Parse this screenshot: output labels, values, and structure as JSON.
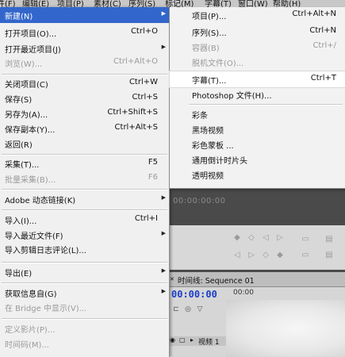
{
  "menubar": {
    "items": [
      "件(F)",
      "编辑(E)",
      "项目(P)",
      "素材(C)",
      "序列(S)",
      "标记(M)",
      "字幕(T)",
      "窗口(W)",
      "帮助(H)"
    ]
  },
  "file_menu": {
    "new": {
      "label": "新建(N)"
    },
    "open_project": {
      "label": "打开项目(O)...",
      "shortcut": "Ctrl+O"
    },
    "open_recent": {
      "label": "打开最近项目(J)"
    },
    "browse": {
      "label": "浏览(W)...",
      "shortcut": "Ctrl+Alt+O"
    },
    "close_project": {
      "label": "关闭项目(C)",
      "shortcut": "Ctrl+W"
    },
    "save": {
      "label": "保存(S)",
      "shortcut": "Ctrl+S"
    },
    "save_as": {
      "label": "另存为(A)...",
      "shortcut": "Ctrl+Shift+S"
    },
    "save_copy": {
      "label": "保存副本(Y)...",
      "shortcut": "Ctrl+Alt+S"
    },
    "revert": {
      "label": "返回(R)"
    },
    "capture": {
      "label": "采集(T)...",
      "shortcut": "F5"
    },
    "batch_capture": {
      "label": "批量采集(B)...",
      "shortcut": "F6"
    },
    "dynamic_link": {
      "label": "Adobe 动态链接(K)"
    },
    "import": {
      "label": "导入(I)...",
      "shortcut": "Ctrl+I"
    },
    "import_recent": {
      "label": "导入最近文件(F)"
    },
    "import_clip_notes": {
      "label": "导入剪辑日志评论(L)..."
    },
    "export": {
      "label": "导出(E)"
    },
    "get_properties": {
      "label": "获取信息自(G)"
    },
    "reveal_bridge": {
      "label": "在 Bridge 中显示(V)..."
    },
    "define_movie": {
      "label": "定义影片(P)..."
    },
    "timecode": {
      "label": "时间码(M)..."
    }
  },
  "new_submenu": {
    "project": {
      "label": "项目(P)...",
      "shortcut": "Ctrl+Alt+N"
    },
    "sequence": {
      "label": "序列(S)...",
      "shortcut": "Ctrl+N"
    },
    "bin": {
      "label": "容器(B)",
      "shortcut": "Ctrl+/"
    },
    "offline_file": {
      "label": "脱机文件(O)..."
    },
    "title": {
      "label": "字幕(T)...",
      "shortcut": "Ctrl+T"
    },
    "photoshop": {
      "label": "Photoshop 文件(H)..."
    },
    "bars_tone": {
      "label": "彩条"
    },
    "black_video": {
      "label": "黑场视频"
    },
    "color_matte": {
      "label": "彩色蒙板 ..."
    },
    "countdown": {
      "label": "通用倒计时片头"
    },
    "transparent_video": {
      "label": "透明视频"
    }
  },
  "monitor": {
    "timecode": "00:00:00:00"
  },
  "timeline": {
    "tab_label": "时间线: Sequence 01",
    "timecode": "00:00:00",
    "ruler_label": "00:00",
    "track_label": "视频 1"
  }
}
